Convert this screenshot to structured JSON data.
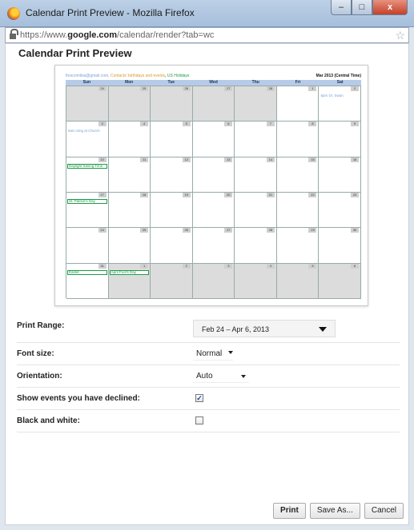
{
  "window": {
    "title": "Calendar Print Preview - Mozilla Firefox",
    "controls": {
      "minimize": "–",
      "maximize": "□",
      "close": "x"
    }
  },
  "urlbar": {
    "prefix": "https://www.",
    "domain": "google.com",
    "path": "/calendar/render?tab=wc"
  },
  "page": {
    "title": "Calendar Print Preview"
  },
  "preview": {
    "sources": {
      "user": "frescomlisa@gmail.com, ",
      "contacts": "Contacts' birthdays and events",
      "sep": ", ",
      "holidays": "US Holidays"
    },
    "month_label": "Mar 2013 (Central Time)",
    "weekdays": [
      "Sun",
      "Mon",
      "Tue",
      "Wed",
      "Thu",
      "Fri",
      "Sat"
    ],
    "weeks": [
      [
        {
          "n": "24",
          "s": true
        },
        {
          "n": "25",
          "s": true
        },
        {
          "n": "26",
          "s": true
        },
        {
          "n": "27",
          "s": true
        },
        {
          "n": "28",
          "s": true
        },
        {
          "n": "1"
        },
        {
          "n": "2",
          "ev": "5pm Dr. Swan"
        }
      ],
      [
        {
          "n": "3",
          "ev": "9am Sing at Church"
        },
        {
          "n": "4"
        },
        {
          "n": "5"
        },
        {
          "n": "6"
        },
        {
          "n": "7"
        },
        {
          "n": "8"
        },
        {
          "n": "9"
        }
      ],
      [
        {
          "n": "10",
          "box": "Daylight Saving Time"
        },
        {
          "n": "11"
        },
        {
          "n": "12"
        },
        {
          "n": "13"
        },
        {
          "n": "14"
        },
        {
          "n": "15"
        },
        {
          "n": "16"
        }
      ],
      [
        {
          "n": "17",
          "box": "St. Patrick's Day"
        },
        {
          "n": "18"
        },
        {
          "n": "19"
        },
        {
          "n": "20"
        },
        {
          "n": "21"
        },
        {
          "n": "22"
        },
        {
          "n": "23"
        }
      ],
      [
        {
          "n": "24"
        },
        {
          "n": "25"
        },
        {
          "n": "26"
        },
        {
          "n": "27"
        },
        {
          "n": "28"
        },
        {
          "n": "29"
        },
        {
          "n": "30"
        }
      ],
      [
        {
          "n": "31",
          "box": "Easter"
        },
        {
          "n": "1",
          "box": "April Fool's Day",
          "s": true
        },
        {
          "n": "2",
          "s": true
        },
        {
          "n": "3",
          "s": true
        },
        {
          "n": "4",
          "s": true
        },
        {
          "n": "5",
          "s": true
        },
        {
          "n": "6",
          "s": true
        }
      ]
    ]
  },
  "settings": {
    "print_range": {
      "label": "Print Range:",
      "value": "Feb 24 – Apr 6, 2013"
    },
    "font_size": {
      "label": "Font size:",
      "value": "Normal"
    },
    "orientation": {
      "label": "Orientation:",
      "value": "Auto"
    },
    "show_declined": {
      "label": "Show events you have declined:",
      "checked": true,
      "mark": "✓"
    },
    "black_white": {
      "label": "Black and white:",
      "checked": false
    }
  },
  "buttons": {
    "print": "Print",
    "save_as": "Save As...",
    "cancel": "Cancel"
  }
}
